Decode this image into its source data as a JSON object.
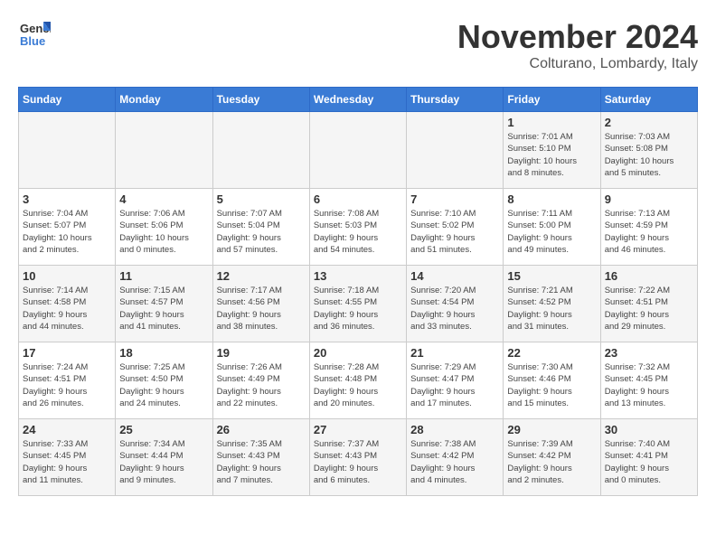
{
  "header": {
    "logo_general": "General",
    "logo_blue": "Blue",
    "month": "November 2024",
    "location": "Colturano, Lombardy, Italy"
  },
  "weekdays": [
    "Sunday",
    "Monday",
    "Tuesday",
    "Wednesday",
    "Thursday",
    "Friday",
    "Saturday"
  ],
  "weeks": [
    {
      "days": [
        {
          "date": "",
          "info": ""
        },
        {
          "date": "",
          "info": ""
        },
        {
          "date": "",
          "info": ""
        },
        {
          "date": "",
          "info": ""
        },
        {
          "date": "",
          "info": ""
        },
        {
          "date": "1",
          "info": "Sunrise: 7:01 AM\nSunset: 5:10 PM\nDaylight: 10 hours\nand 8 minutes."
        },
        {
          "date": "2",
          "info": "Sunrise: 7:03 AM\nSunset: 5:08 PM\nDaylight: 10 hours\nand 5 minutes."
        }
      ]
    },
    {
      "days": [
        {
          "date": "3",
          "info": "Sunrise: 7:04 AM\nSunset: 5:07 PM\nDaylight: 10 hours\nand 2 minutes."
        },
        {
          "date": "4",
          "info": "Sunrise: 7:06 AM\nSunset: 5:06 PM\nDaylight: 10 hours\nand 0 minutes."
        },
        {
          "date": "5",
          "info": "Sunrise: 7:07 AM\nSunset: 5:04 PM\nDaylight: 9 hours\nand 57 minutes."
        },
        {
          "date": "6",
          "info": "Sunrise: 7:08 AM\nSunset: 5:03 PM\nDaylight: 9 hours\nand 54 minutes."
        },
        {
          "date": "7",
          "info": "Sunrise: 7:10 AM\nSunset: 5:02 PM\nDaylight: 9 hours\nand 51 minutes."
        },
        {
          "date": "8",
          "info": "Sunrise: 7:11 AM\nSunset: 5:00 PM\nDaylight: 9 hours\nand 49 minutes."
        },
        {
          "date": "9",
          "info": "Sunrise: 7:13 AM\nSunset: 4:59 PM\nDaylight: 9 hours\nand 46 minutes."
        }
      ]
    },
    {
      "days": [
        {
          "date": "10",
          "info": "Sunrise: 7:14 AM\nSunset: 4:58 PM\nDaylight: 9 hours\nand 44 minutes."
        },
        {
          "date": "11",
          "info": "Sunrise: 7:15 AM\nSunset: 4:57 PM\nDaylight: 9 hours\nand 41 minutes."
        },
        {
          "date": "12",
          "info": "Sunrise: 7:17 AM\nSunset: 4:56 PM\nDaylight: 9 hours\nand 38 minutes."
        },
        {
          "date": "13",
          "info": "Sunrise: 7:18 AM\nSunset: 4:55 PM\nDaylight: 9 hours\nand 36 minutes."
        },
        {
          "date": "14",
          "info": "Sunrise: 7:20 AM\nSunset: 4:54 PM\nDaylight: 9 hours\nand 33 minutes."
        },
        {
          "date": "15",
          "info": "Sunrise: 7:21 AM\nSunset: 4:52 PM\nDaylight: 9 hours\nand 31 minutes."
        },
        {
          "date": "16",
          "info": "Sunrise: 7:22 AM\nSunset: 4:51 PM\nDaylight: 9 hours\nand 29 minutes."
        }
      ]
    },
    {
      "days": [
        {
          "date": "17",
          "info": "Sunrise: 7:24 AM\nSunset: 4:51 PM\nDaylight: 9 hours\nand 26 minutes."
        },
        {
          "date": "18",
          "info": "Sunrise: 7:25 AM\nSunset: 4:50 PM\nDaylight: 9 hours\nand 24 minutes."
        },
        {
          "date": "19",
          "info": "Sunrise: 7:26 AM\nSunset: 4:49 PM\nDaylight: 9 hours\nand 22 minutes."
        },
        {
          "date": "20",
          "info": "Sunrise: 7:28 AM\nSunset: 4:48 PM\nDaylight: 9 hours\nand 20 minutes."
        },
        {
          "date": "21",
          "info": "Sunrise: 7:29 AM\nSunset: 4:47 PM\nDaylight: 9 hours\nand 17 minutes."
        },
        {
          "date": "22",
          "info": "Sunrise: 7:30 AM\nSunset: 4:46 PM\nDaylight: 9 hours\nand 15 minutes."
        },
        {
          "date": "23",
          "info": "Sunrise: 7:32 AM\nSunset: 4:45 PM\nDaylight: 9 hours\nand 13 minutes."
        }
      ]
    },
    {
      "days": [
        {
          "date": "24",
          "info": "Sunrise: 7:33 AM\nSunset: 4:45 PM\nDaylight: 9 hours\nand 11 minutes."
        },
        {
          "date": "25",
          "info": "Sunrise: 7:34 AM\nSunset: 4:44 PM\nDaylight: 9 hours\nand 9 minutes."
        },
        {
          "date": "26",
          "info": "Sunrise: 7:35 AM\nSunset: 4:43 PM\nDaylight: 9 hours\nand 7 minutes."
        },
        {
          "date": "27",
          "info": "Sunrise: 7:37 AM\nSunset: 4:43 PM\nDaylight: 9 hours\nand 6 minutes."
        },
        {
          "date": "28",
          "info": "Sunrise: 7:38 AM\nSunset: 4:42 PM\nDaylight: 9 hours\nand 4 minutes."
        },
        {
          "date": "29",
          "info": "Sunrise: 7:39 AM\nSunset: 4:42 PM\nDaylight: 9 hours\nand 2 minutes."
        },
        {
          "date": "30",
          "info": "Sunrise: 7:40 AM\nSunset: 4:41 PM\nDaylight: 9 hours\nand 0 minutes."
        }
      ]
    }
  ]
}
